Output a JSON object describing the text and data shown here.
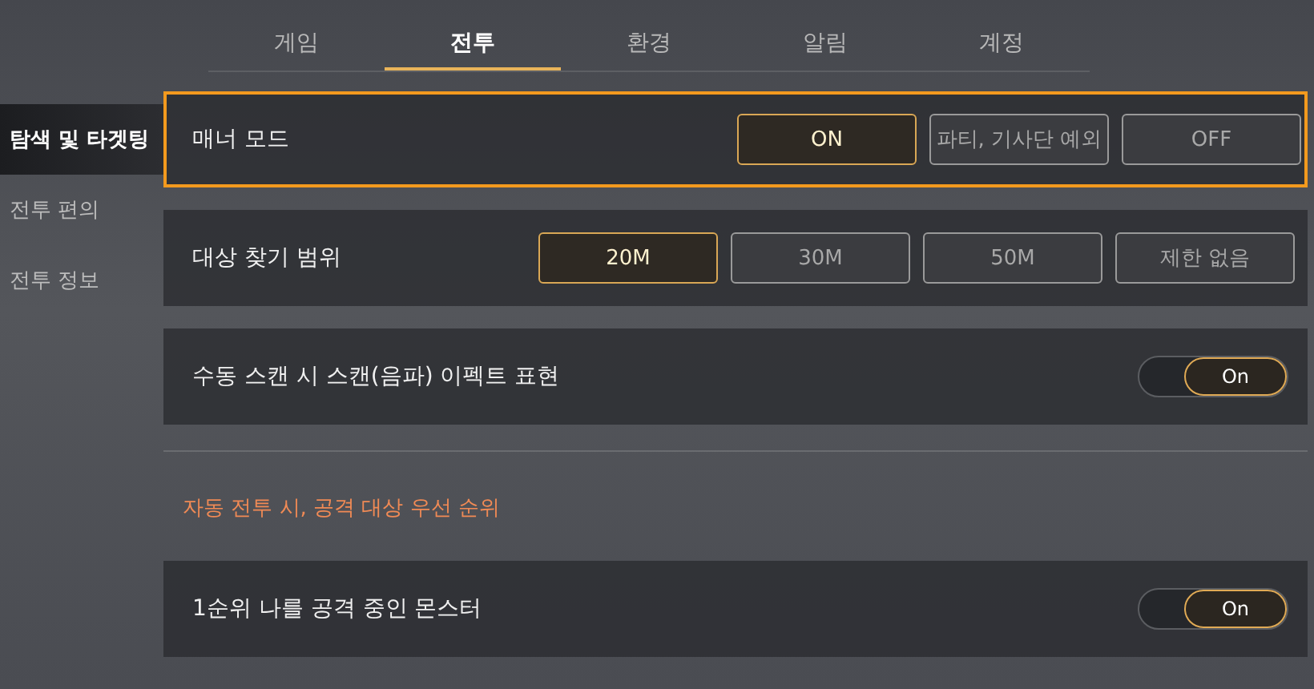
{
  "tabs": [
    {
      "label": "게임",
      "selected": false
    },
    {
      "label": "전투",
      "selected": true
    },
    {
      "label": "환경",
      "selected": false
    },
    {
      "label": "알림",
      "selected": false
    },
    {
      "label": "계정",
      "selected": false
    }
  ],
  "sidebar": {
    "items": [
      {
        "label": "탐색 및 타겟팅",
        "selected": true
      },
      {
        "label": "전투 편의",
        "selected": false
      },
      {
        "label": "전투 정보",
        "selected": false
      }
    ]
  },
  "settings": [
    {
      "kind": "options",
      "label": "매너 모드",
      "highlighted": true,
      "options": [
        {
          "label": "ON",
          "selected": true
        },
        {
          "label": "파티, 기사단 예외",
          "selected": false
        },
        {
          "label": "OFF",
          "selected": false
        }
      ]
    },
    {
      "kind": "options",
      "label": "대상 찾기 범위",
      "highlighted": false,
      "options": [
        {
          "label": "20M",
          "selected": true
        },
        {
          "label": "30M",
          "selected": false
        },
        {
          "label": "50M",
          "selected": false
        },
        {
          "label": "제한 없음",
          "selected": false
        }
      ]
    },
    {
      "kind": "toggle",
      "label": "수동 스캔 시 스캔(음파) 이펙트 표현",
      "highlighted": false,
      "on": true,
      "toggle_label": "On"
    },
    {
      "kind": "divider"
    },
    {
      "kind": "heading",
      "label": "자동 전투 시, 공격 대상 우선 순위"
    },
    {
      "kind": "toggle",
      "label": "1순위 나를 공격 중인 몬스터",
      "highlighted": false,
      "on": true,
      "toggle_label": "On"
    }
  ]
}
